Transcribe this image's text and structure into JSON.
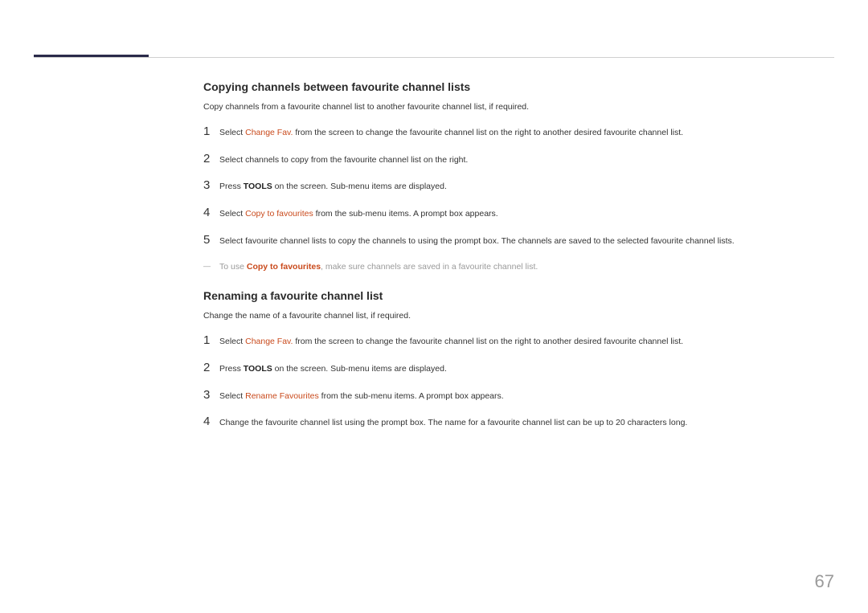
{
  "page_number": "67",
  "section1": {
    "title": "Copying channels between favourite channel lists",
    "intro": "Copy channels from a favourite channel list to another favourite channel list, if required.",
    "steps": [
      {
        "num": "1",
        "pre": "Select ",
        "accent": "Change Fav.",
        "post": " from the screen to change the favourite channel list on the right to another desired favourite channel list."
      },
      {
        "num": "2",
        "text": "Select channels to copy from the favourite channel list on the right."
      },
      {
        "num": "3",
        "pre": "Press ",
        "bold": "TOOLS",
        "post": " on the screen. Sub-menu items are displayed."
      },
      {
        "num": "4",
        "pre": "Select ",
        "accent": "Copy to favourites",
        "post": " from the sub-menu items. A prompt box appears."
      },
      {
        "num": "5",
        "text": "Select favourite channel lists to copy the channels to using the prompt box. The channels are saved to the selected favourite channel lists."
      }
    ],
    "note": {
      "pre": "To use ",
      "accent": "Copy to favourites",
      "post": ", make sure channels are saved in a favourite channel list."
    }
  },
  "section2": {
    "title": "Renaming a favourite channel list",
    "intro": "Change the name of a favourite channel list, if required.",
    "steps": [
      {
        "num": "1",
        "pre": "Select ",
        "accent": "Change Fav.",
        "post": " from the screen to change the favourite channel list on the right to another desired favourite channel list."
      },
      {
        "num": "2",
        "pre": "Press ",
        "bold": "TOOLS",
        "post": " on the screen. Sub-menu items are displayed."
      },
      {
        "num": "3",
        "pre": "Select ",
        "accent": "Rename Favourites",
        "post": " from the sub-menu items. A prompt box appears."
      },
      {
        "num": "4",
        "text": "Change the favourite channel list using the prompt box. The name for a favourite channel list can be up to 20 characters long."
      }
    ]
  }
}
